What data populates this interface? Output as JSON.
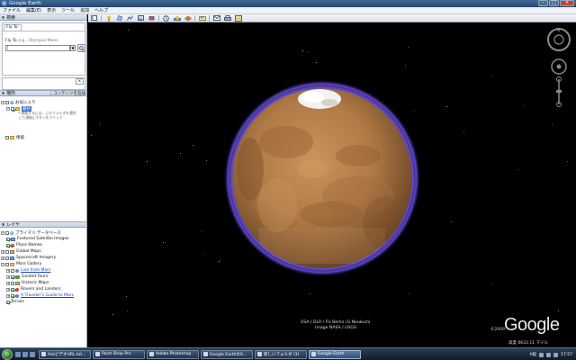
{
  "window": {
    "title": "Google Earth",
    "controls": [
      "–",
      "□",
      "×"
    ]
  },
  "menu": [
    "ファイル",
    "編集(E)",
    "表示",
    "ツール",
    "追加",
    "ヘルプ"
  ],
  "search": {
    "section_label": "検索",
    "tab_label": "Fly To",
    "flyto_label": "Fly To",
    "flyto_hint": "e.g., Olympus Mons",
    "input_value": "|",
    "go_icon": "search-icon",
    "clear_label": "x"
  },
  "places": {
    "section_label": "場所",
    "add_content_label": "コンテンツを追加",
    "items": [
      {
        "label": "お気に入り",
        "checked": false
      },
      {
        "label": "最初",
        "checked": true
      },
      {
        "label": "保留",
        "checked": false
      }
    ],
    "tip_text": "て開始するには、このフォルダを選択して[開始] ボタンをクリック"
  },
  "layers": {
    "section_label": "レイヤ",
    "items": [
      {
        "label": "プライマリ データベース",
        "checked": false,
        "link": false
      },
      {
        "label": "Featured Satellite Images",
        "checked": true,
        "link": false
      },
      {
        "label": "Place Names",
        "checked": true,
        "link": false
      },
      {
        "label": "Global Maps",
        "checked": false,
        "link": false
      },
      {
        "label": "Spacecraft Imagery",
        "checked": false,
        "link": false
      },
      {
        "label": "Mars Gallery",
        "checked": false,
        "link": false
      },
      {
        "label": "Live from Mars",
        "checked": false,
        "link": true
      },
      {
        "label": "Guided Tours",
        "checked": true,
        "link": false
      },
      {
        "label": "Historic Maps",
        "checked": false,
        "link": false
      },
      {
        "label": "Rovers and Landers",
        "checked": true,
        "link": false
      },
      {
        "label": "A Traveler's Guide to Mars",
        "checked": true,
        "link": true
      },
      {
        "label": "Terrain",
        "checked": true,
        "link": false
      }
    ]
  },
  "viewport": {
    "attribution_line1": "ESA / DLR / FU Berlin (G.Neukum)",
    "attribution_line2": "Image NASA / USGS",
    "copyright": "©2009",
    "logo": "Google",
    "altitude_label": "高度",
    "altitude_value": "6633.11 マイル"
  },
  "taskbar": {
    "tasks": [
      {
        "label": "AskビデオURL.txt...",
        "active": false
      },
      {
        "label": "Paint Shop Pro",
        "active": false
      },
      {
        "label": "Adobe Photoshop",
        "active": false
      },
      {
        "label": "Google EarthのX...",
        "active": false
      },
      {
        "label": "新しいフォルダ (3)",
        "active": false
      },
      {
        "label": "Google Earth",
        "active": true
      }
    ],
    "tray_lang": "A般",
    "clock": "17:57"
  },
  "colors": {
    "planet_base": "#b07a46",
    "atmosphere": "#6a4fd8",
    "link": "#1144cc"
  }
}
